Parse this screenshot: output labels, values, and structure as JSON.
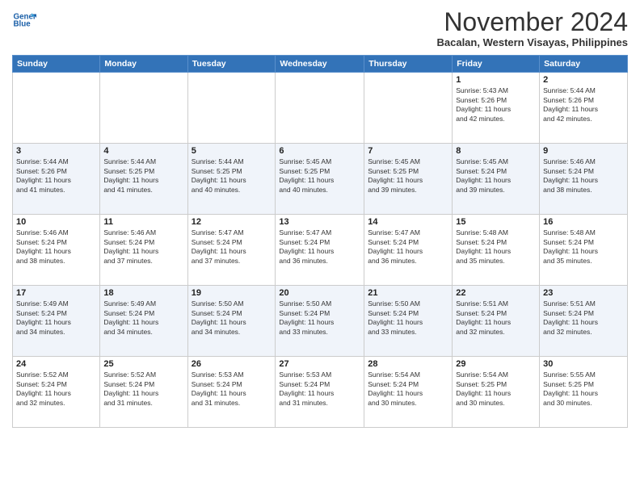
{
  "header": {
    "logo_line1": "General",
    "logo_line2": "Blue",
    "month_title": "November 2024",
    "location": "Bacalan, Western Visayas, Philippines"
  },
  "weekdays": [
    "Sunday",
    "Monday",
    "Tuesday",
    "Wednesday",
    "Thursday",
    "Friday",
    "Saturday"
  ],
  "weeks": [
    [
      {
        "day": "",
        "info": ""
      },
      {
        "day": "",
        "info": ""
      },
      {
        "day": "",
        "info": ""
      },
      {
        "day": "",
        "info": ""
      },
      {
        "day": "",
        "info": ""
      },
      {
        "day": "1",
        "info": "Sunrise: 5:43 AM\nSunset: 5:26 PM\nDaylight: 11 hours\nand 42 minutes."
      },
      {
        "day": "2",
        "info": "Sunrise: 5:44 AM\nSunset: 5:26 PM\nDaylight: 11 hours\nand 42 minutes."
      }
    ],
    [
      {
        "day": "3",
        "info": "Sunrise: 5:44 AM\nSunset: 5:26 PM\nDaylight: 11 hours\nand 41 minutes."
      },
      {
        "day": "4",
        "info": "Sunrise: 5:44 AM\nSunset: 5:25 PM\nDaylight: 11 hours\nand 41 minutes."
      },
      {
        "day": "5",
        "info": "Sunrise: 5:44 AM\nSunset: 5:25 PM\nDaylight: 11 hours\nand 40 minutes."
      },
      {
        "day": "6",
        "info": "Sunrise: 5:45 AM\nSunset: 5:25 PM\nDaylight: 11 hours\nand 40 minutes."
      },
      {
        "day": "7",
        "info": "Sunrise: 5:45 AM\nSunset: 5:25 PM\nDaylight: 11 hours\nand 39 minutes."
      },
      {
        "day": "8",
        "info": "Sunrise: 5:45 AM\nSunset: 5:24 PM\nDaylight: 11 hours\nand 39 minutes."
      },
      {
        "day": "9",
        "info": "Sunrise: 5:46 AM\nSunset: 5:24 PM\nDaylight: 11 hours\nand 38 minutes."
      }
    ],
    [
      {
        "day": "10",
        "info": "Sunrise: 5:46 AM\nSunset: 5:24 PM\nDaylight: 11 hours\nand 38 minutes."
      },
      {
        "day": "11",
        "info": "Sunrise: 5:46 AM\nSunset: 5:24 PM\nDaylight: 11 hours\nand 37 minutes."
      },
      {
        "day": "12",
        "info": "Sunrise: 5:47 AM\nSunset: 5:24 PM\nDaylight: 11 hours\nand 37 minutes."
      },
      {
        "day": "13",
        "info": "Sunrise: 5:47 AM\nSunset: 5:24 PM\nDaylight: 11 hours\nand 36 minutes."
      },
      {
        "day": "14",
        "info": "Sunrise: 5:47 AM\nSunset: 5:24 PM\nDaylight: 11 hours\nand 36 minutes."
      },
      {
        "day": "15",
        "info": "Sunrise: 5:48 AM\nSunset: 5:24 PM\nDaylight: 11 hours\nand 35 minutes."
      },
      {
        "day": "16",
        "info": "Sunrise: 5:48 AM\nSunset: 5:24 PM\nDaylight: 11 hours\nand 35 minutes."
      }
    ],
    [
      {
        "day": "17",
        "info": "Sunrise: 5:49 AM\nSunset: 5:24 PM\nDaylight: 11 hours\nand 34 minutes."
      },
      {
        "day": "18",
        "info": "Sunrise: 5:49 AM\nSunset: 5:24 PM\nDaylight: 11 hours\nand 34 minutes."
      },
      {
        "day": "19",
        "info": "Sunrise: 5:50 AM\nSunset: 5:24 PM\nDaylight: 11 hours\nand 34 minutes."
      },
      {
        "day": "20",
        "info": "Sunrise: 5:50 AM\nSunset: 5:24 PM\nDaylight: 11 hours\nand 33 minutes."
      },
      {
        "day": "21",
        "info": "Sunrise: 5:50 AM\nSunset: 5:24 PM\nDaylight: 11 hours\nand 33 minutes."
      },
      {
        "day": "22",
        "info": "Sunrise: 5:51 AM\nSunset: 5:24 PM\nDaylight: 11 hours\nand 32 minutes."
      },
      {
        "day": "23",
        "info": "Sunrise: 5:51 AM\nSunset: 5:24 PM\nDaylight: 11 hours\nand 32 minutes."
      }
    ],
    [
      {
        "day": "24",
        "info": "Sunrise: 5:52 AM\nSunset: 5:24 PM\nDaylight: 11 hours\nand 32 minutes."
      },
      {
        "day": "25",
        "info": "Sunrise: 5:52 AM\nSunset: 5:24 PM\nDaylight: 11 hours\nand 31 minutes."
      },
      {
        "day": "26",
        "info": "Sunrise: 5:53 AM\nSunset: 5:24 PM\nDaylight: 11 hours\nand 31 minutes."
      },
      {
        "day": "27",
        "info": "Sunrise: 5:53 AM\nSunset: 5:24 PM\nDaylight: 11 hours\nand 31 minutes."
      },
      {
        "day": "28",
        "info": "Sunrise: 5:54 AM\nSunset: 5:24 PM\nDaylight: 11 hours\nand 30 minutes."
      },
      {
        "day": "29",
        "info": "Sunrise: 5:54 AM\nSunset: 5:25 PM\nDaylight: 11 hours\nand 30 minutes."
      },
      {
        "day": "30",
        "info": "Sunrise: 5:55 AM\nSunset: 5:25 PM\nDaylight: 11 hours\nand 30 minutes."
      }
    ]
  ]
}
